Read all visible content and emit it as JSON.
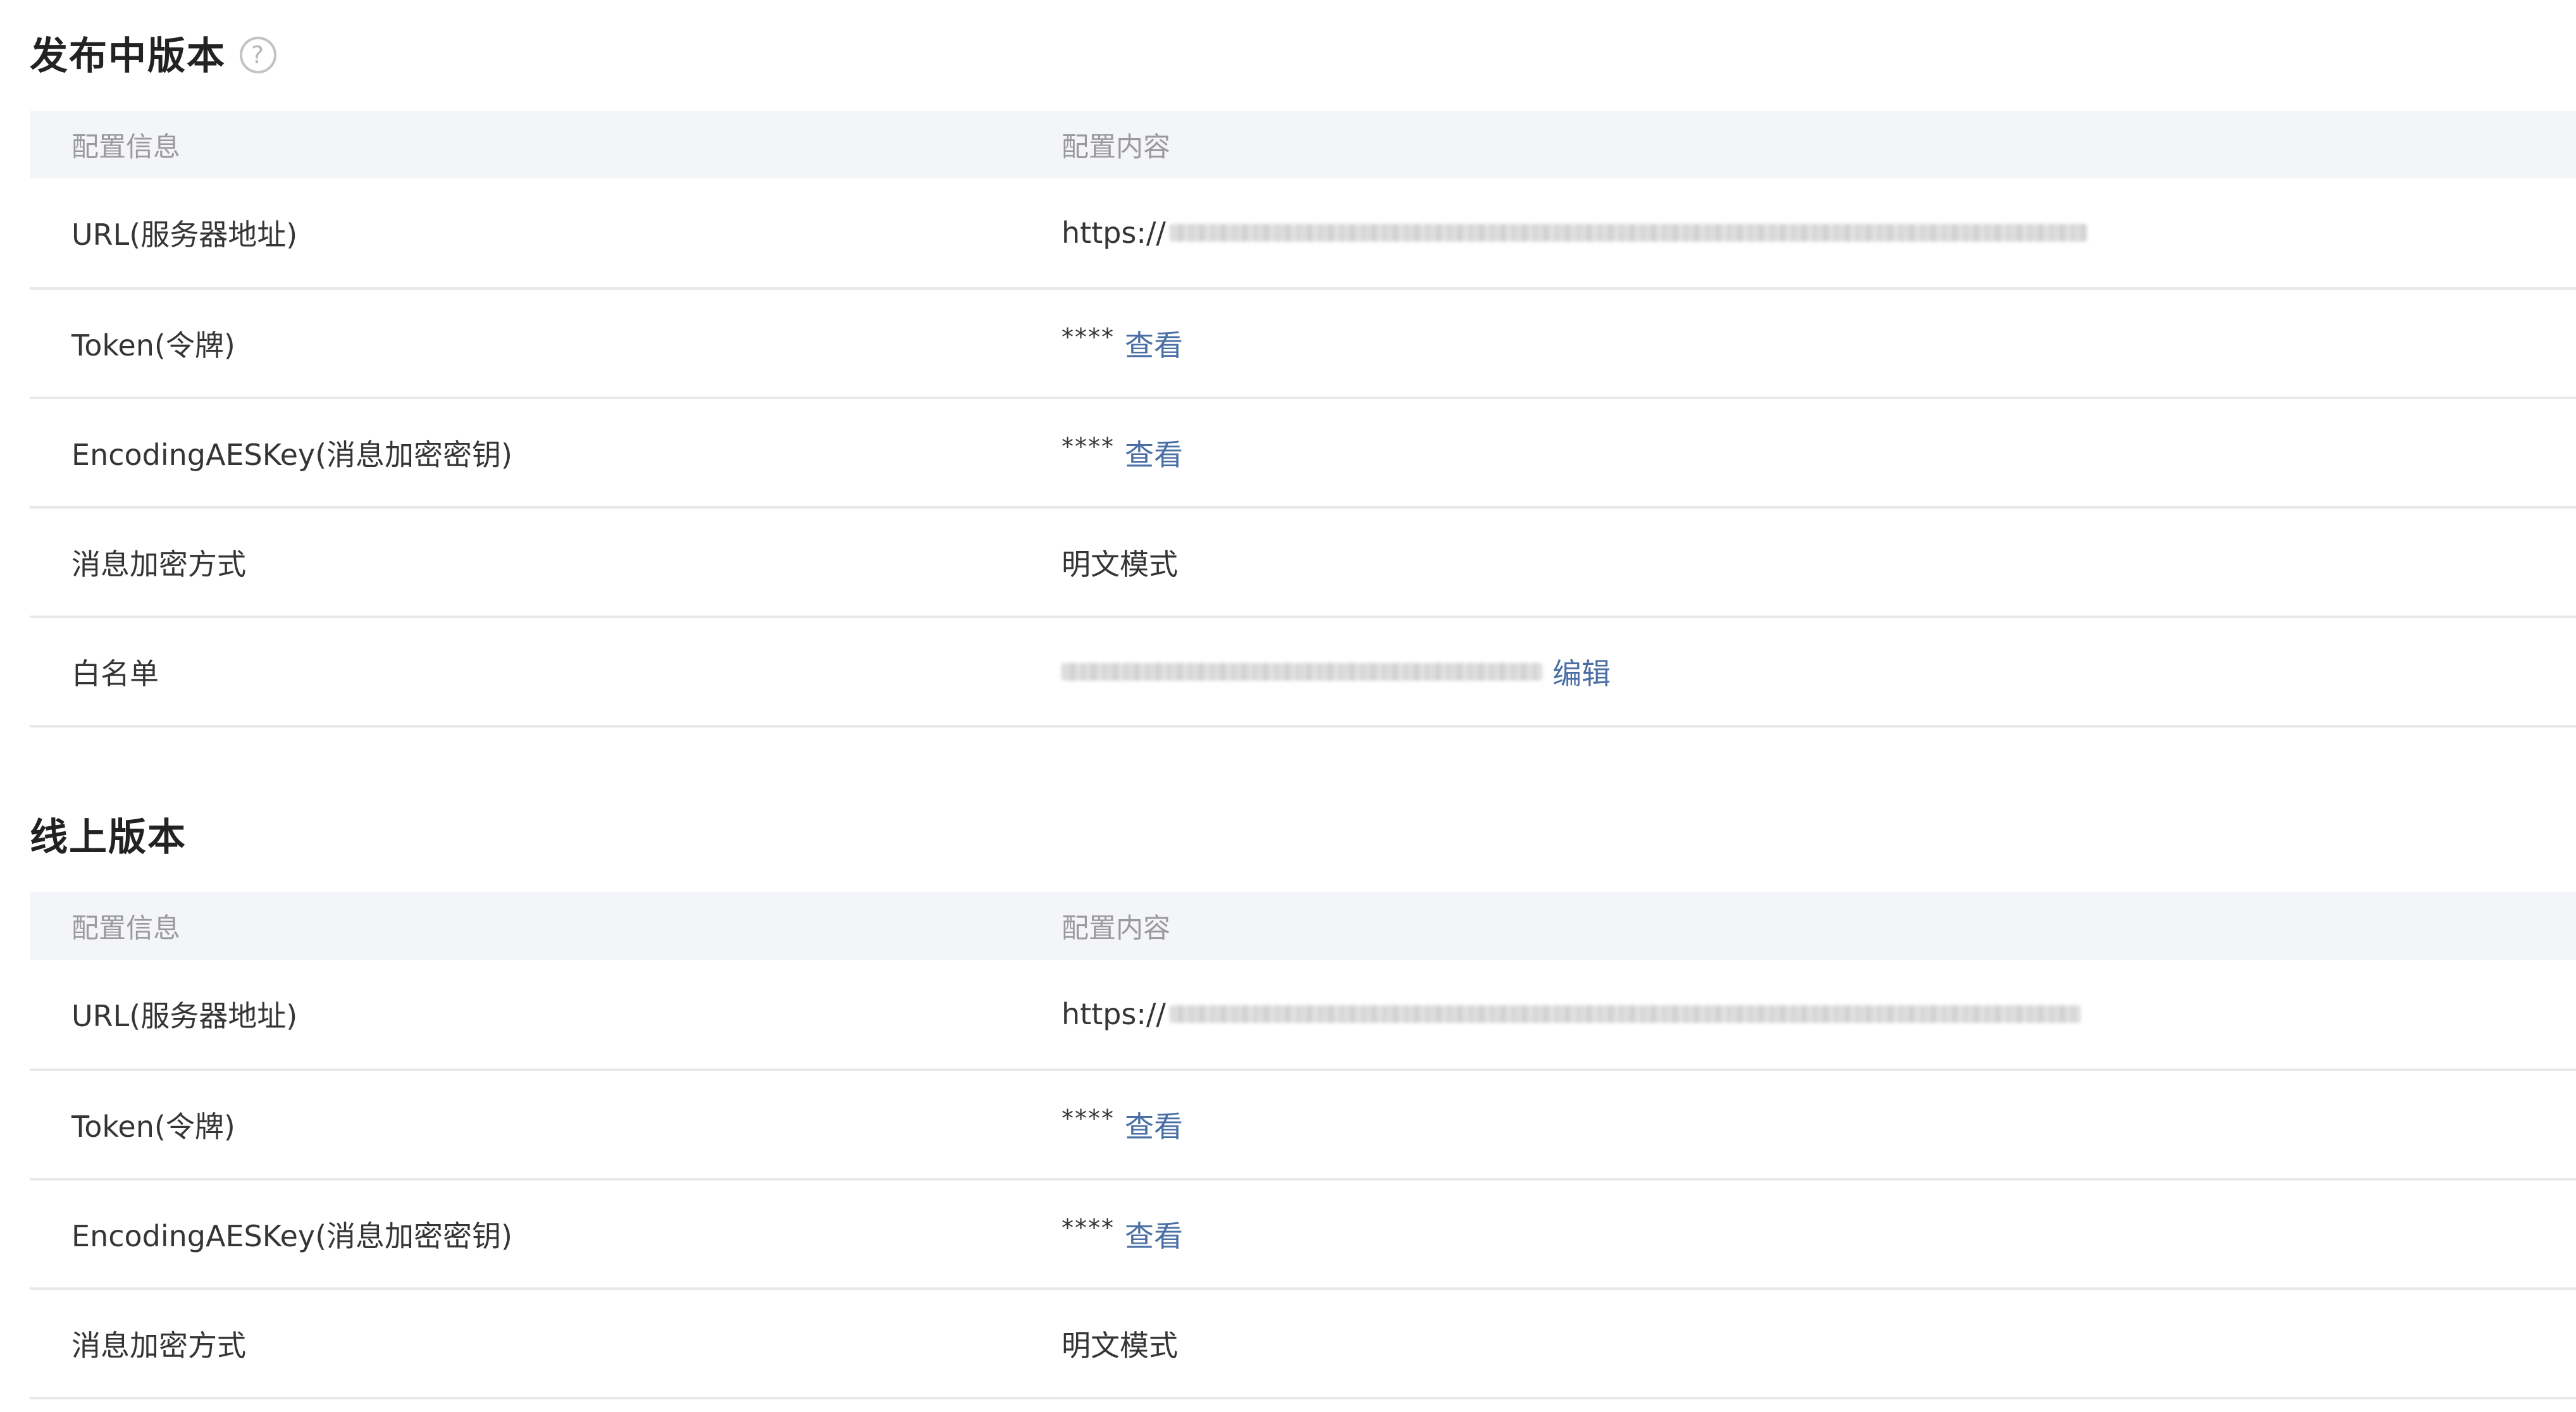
{
  "sections": [
    {
      "title": "发布中版本",
      "help_icon": "question-circle-icon",
      "header": {
        "info": "配置信息",
        "content": "配置内容"
      },
      "rows": [
        {
          "info": "URL(服务器地址)",
          "value": "https://"
        },
        {
          "info": "Token(令牌)",
          "value": "****",
          "link": "查看"
        },
        {
          "info": "EncodingAESKey(消息加密密钥)",
          "value": "****",
          "link": "查看"
        },
        {
          "info": "消息加密方式",
          "value": "明文模式"
        },
        {
          "info": "白名单",
          "link": "编辑"
        }
      ]
    },
    {
      "title": "线上版本",
      "header": {
        "info": "配置信息",
        "content": "配置内容"
      },
      "rows": [
        {
          "info": "URL(服务器地址)",
          "value": "https://"
        },
        {
          "info": "Token(令牌)",
          "value": "****",
          "link": "查看"
        },
        {
          "info": "EncodingAESKey(消息加密密钥)",
          "value": "****",
          "link": "查看"
        },
        {
          "info": "消息加密方式",
          "value": "明文模式"
        }
      ]
    }
  ],
  "colors": {
    "header_bg": "#f4f5f9",
    "link": "#4a6fa5",
    "divider": "#e8e8e8",
    "text": "#353535",
    "header_text": "#9a9a9a"
  }
}
